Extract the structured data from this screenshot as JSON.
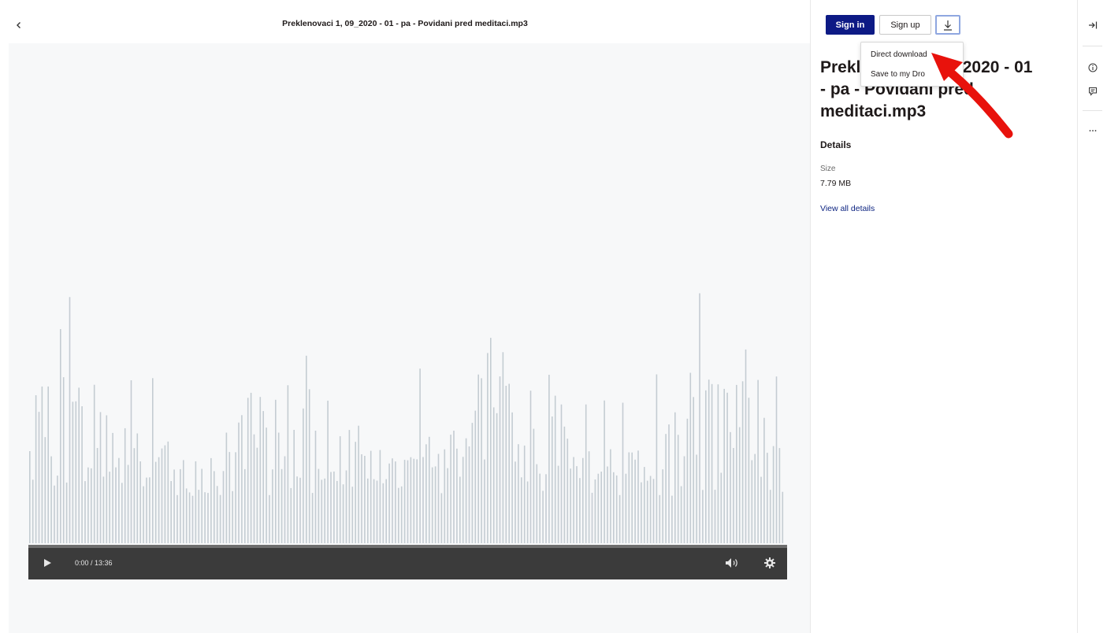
{
  "header": {
    "file_title": "Preklenovaci 1, 09_2020 - 01 - pa - Povidani pred meditaci.mp3",
    "back_icon": "chevron-left-icon"
  },
  "player": {
    "time": "0:00 / 13:36",
    "icons": [
      "play-icon",
      "volume-icon",
      "gear-icon"
    ]
  },
  "sidebar": {
    "sign_in": "Sign in",
    "sign_up": "Sign up",
    "download_icon": "download-icon",
    "file_heading_line1": "Prekl",
    "file_heading_line1_right": "9_2020 - 01",
    "file_heading_line2": "- pa - Povidani pred",
    "file_heading_line3": "meditaci.mp3",
    "details_heading": "Details",
    "size_label": "Size",
    "size_value": "7.79 MB",
    "view_all": "View all details"
  },
  "download_menu": {
    "items": [
      "Direct download",
      "Save to my Dro"
    ]
  },
  "rail": {
    "icons": [
      "collapse-panel-icon",
      "info-icon",
      "comment-icon",
      "more-icon"
    ]
  },
  "colors": {
    "primary": "#0d1a85",
    "waveform": "#c4ccd2",
    "player_bg": "#3b3b3b",
    "annotation": "#e8120c"
  }
}
